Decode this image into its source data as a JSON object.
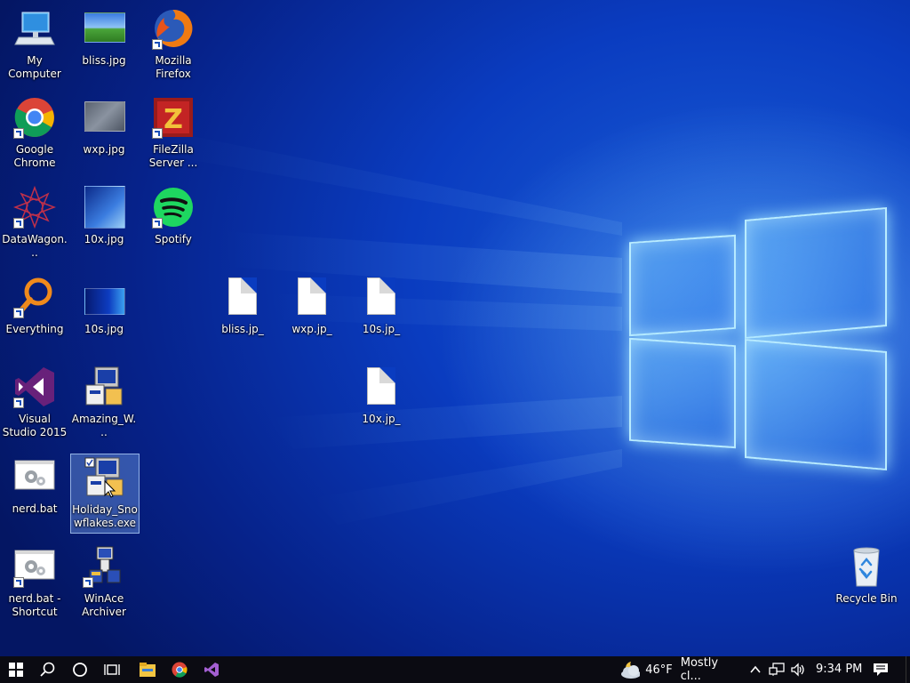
{
  "desktop": {
    "icons": {
      "my_computer": "My Computer",
      "bliss_jpg": "bliss.jpg",
      "firefox": "Mozilla Firefox",
      "chrome": "Google Chrome",
      "wxp_jpg": "wxp.jpg",
      "filezilla": "FileZilla Server ...",
      "datawagon": "DataWagon...",
      "x10_jpg": "10x.jpg",
      "spotify": "Spotify",
      "everything": "Everything",
      "s10_jpg": "10s.jpg",
      "bliss_jp_": "bliss.jp_",
      "wxp_jp_": "wxp.jp_",
      "s10_jp_": "10s.jp_",
      "vs2015": "Visual Studio 2015",
      "amazing": "Amazing_W...",
      "x10_jp_": "10x.jp_",
      "nerd_bat": "nerd.bat",
      "holiday": "Holiday_Snowflakes.exe",
      "nerd_shortcut": "nerd.bat - Shortcut",
      "winace": "WinAce Archiver",
      "recycle_bin": "Recycle Bin"
    }
  },
  "taskbar": {
    "start_icon": "windows-logo-icon",
    "search_icon": "search-icon",
    "cortana_icon": "cortana-circle-icon",
    "task_view_icon": "task-view-icon",
    "pinned": [
      "file-explorer-icon",
      "chrome-icon",
      "visual-studio-icon"
    ],
    "weather": {
      "temp": "46°F",
      "condition": "Mostly cl..."
    },
    "time": "9:34 PM"
  },
  "colors": {
    "taskbar": "#0b0b12",
    "desktop_blue": "#0a3cc0",
    "logo_glow": "#b9ecff"
  }
}
